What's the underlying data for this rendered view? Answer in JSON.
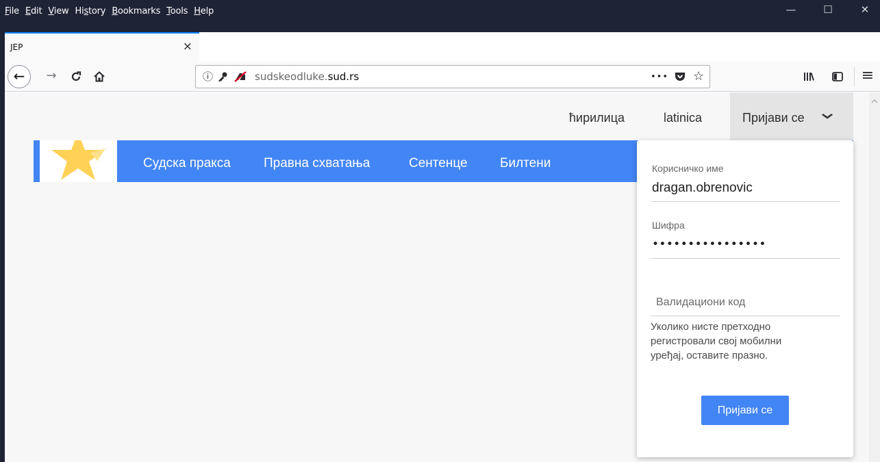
{
  "menu": [
    {
      "mnemonic": "F",
      "rest": "ile"
    },
    {
      "mnemonic": "E",
      "rest": "dit"
    },
    {
      "mnemonic": "V",
      "rest": "iew"
    },
    {
      "pre": "Hi",
      "mnemonic": "s",
      "rest": "tory"
    },
    {
      "mnemonic": "B",
      "rest": "ookmarks"
    },
    {
      "mnemonic": "T",
      "rest": "ools"
    },
    {
      "mnemonic": "H",
      "rest": "elp"
    }
  ],
  "window_controls": {
    "minimize": "—",
    "maximize": "☐",
    "close": "✕"
  },
  "tab": {
    "title": "JEP",
    "close": "×"
  },
  "newtab": "+",
  "nav": {
    "back": "←",
    "forward": "→",
    "reload": "C",
    "home": "⌂"
  },
  "url": {
    "domain_prefix": "sudskeodluke.",
    "domain_main": "sud.rs",
    "page_actions": "•••"
  },
  "toolbar": {
    "library": "|||\\",
    "sidebar": "◫",
    "menu": "≡"
  },
  "top_links": {
    "cyrillic": "ћирилица",
    "latin": "latinica",
    "login": "Пријави се",
    "chevron": "⌄"
  },
  "main_nav": [
    "Судска пракса",
    "Правна схватања",
    "Сентенце",
    "Билтени"
  ],
  "login_form": {
    "username_label": "Корисничко име",
    "username_value": "dragan.obrenovic",
    "password_label": "Шифра",
    "password_value": "••••••••••••••••",
    "code_placeholder": "Валидациони код",
    "hint": "Уколико нисте претходно регистровали свој мобилни уређај, оставите празно.",
    "submit": "Пријави се"
  },
  "colors": {
    "accent": "#4285f4",
    "titlebar": "#1e2336",
    "tab_highlight": "#0a84ff"
  }
}
